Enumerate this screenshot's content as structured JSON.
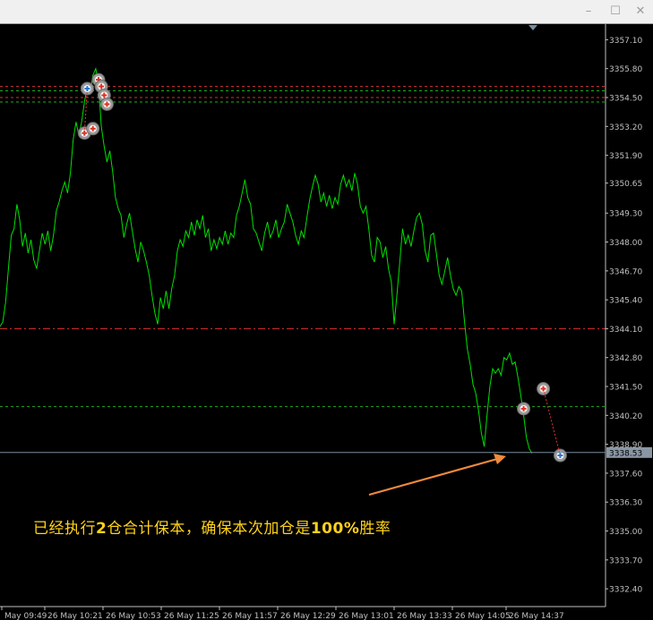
{
  "window": {
    "buttons": [
      "–",
      "☐",
      "✕"
    ]
  },
  "annotation": {
    "part1": "已经执行",
    "num1": "2",
    "part2": "仓合计保本，确保本次加仓是",
    "num2": "100%",
    "part3": "胜率"
  },
  "colors": {
    "background": "#000000",
    "price_line": "#00e000",
    "axis_text": "#c0c0c0",
    "level_red": "#e03030",
    "level_green": "#1fae1f",
    "current_line": "#7a8ca0",
    "arrow": "#f08a3c",
    "annotation": "#ffd21a"
  },
  "chart_data": {
    "type": "line",
    "ylim": [
      3331.6,
      3357.8
    ],
    "y_ticks": [
      "3357.10",
      "3355.80",
      "3354.50",
      "3353.20",
      "3351.90",
      "3350.65",
      "3349.30",
      "3348.00",
      "3346.70",
      "3345.40",
      "3344.10",
      "3342.80",
      "3341.50",
      "3340.20",
      "3338.90",
      "3337.60",
      "3336.30",
      "3335.00",
      "3333.70",
      "3332.40"
    ],
    "x_ticks": [
      "May 09:49",
      "26 May 10:21",
      "26 May 10:53",
      "26 May 11:25",
      "26 May 11:57",
      "26 May 12:29",
      "26 May 13:01",
      "26 May 13:33",
      "26 May 14:05",
      "26 May 14:37"
    ],
    "current_price": "3338.53",
    "series": [
      {
        "values": [
          3344.2,
          3344.4,
          3345.3,
          3346.8,
          3348.3,
          3348.6,
          3349.7,
          3349.0,
          3347.8,
          3348.4,
          3347.5,
          3348.1,
          3347.2,
          3346.8,
          3347.6,
          3348.4,
          3347.9,
          3348.5,
          3347.6,
          3348.3,
          3349.4,
          3349.8,
          3350.3,
          3350.7,
          3350.2,
          3351.1,
          3352.6,
          3353.4,
          3352.8,
          3353.4,
          3354.3,
          3355.0,
          3354.7,
          3355.5,
          3355.8,
          3355.1,
          3353.2,
          3352.3,
          3351.6,
          3352.1,
          3351.2,
          3350.0,
          3349.5,
          3349.2,
          3348.2,
          3348.8,
          3349.3,
          3348.5,
          3347.7,
          3347.1,
          3348.0,
          3347.6,
          3347.1,
          3346.5,
          3345.6,
          3344.8,
          3344.3,
          3345.5,
          3345.0,
          3345.8,
          3345.0,
          3345.9,
          3346.5,
          3347.6,
          3348.1,
          3347.8,
          3348.5,
          3348.2,
          3348.9,
          3348.3,
          3349.0,
          3348.6,
          3349.2,
          3348.2,
          3348.6,
          3347.6,
          3348.1,
          3347.7,
          3348.2,
          3347.9,
          3348.5,
          3347.9,
          3348.4,
          3348.2,
          3349.2,
          3349.6,
          3350.2,
          3350.8,
          3350.0,
          3349.7,
          3348.6,
          3348.4,
          3348.0,
          3347.6,
          3348.4,
          3348.9,
          3348.2,
          3348.5,
          3349.0,
          3348.2,
          3348.6,
          3348.9,
          3349.7,
          3349.3,
          3348.9,
          3348.3,
          3347.9,
          3348.5,
          3348.2,
          3349.1,
          3349.9,
          3350.5,
          3351.0,
          3350.6,
          3349.8,
          3350.2,
          3349.6,
          3350.1,
          3349.5,
          3350.0,
          3349.7,
          3350.6,
          3351.0,
          3350.5,
          3350.8,
          3350.3,
          3351.1,
          3350.6,
          3349.6,
          3349.3,
          3349.6,
          3348.6,
          3347.4,
          3347.1,
          3348.2,
          3348.0,
          3347.3,
          3347.8,
          3346.8,
          3346.2,
          3344.3,
          3345.6,
          3347.1,
          3348.6,
          3347.9,
          3348.3,
          3347.8,
          3348.5,
          3349.1,
          3349.3,
          3348.8,
          3347.6,
          3347.1,
          3348.3,
          3348.4,
          3347.5,
          3346.5,
          3346.1,
          3346.7,
          3347.3,
          3346.5,
          3345.9,
          3345.6,
          3346.0,
          3345.8,
          3344.4,
          3343.2,
          3342.5,
          3341.6,
          3341.2,
          3340.4,
          3339.4,
          3338.8,
          3340.2,
          3341.5,
          3342.3,
          3342.1,
          3342.3,
          3342.0,
          3342.8,
          3342.7,
          3343.0,
          3342.5,
          3342.6,
          3341.9,
          3341.1,
          3340.2,
          3339.2,
          3338.7,
          3338.5
        ]
      }
    ],
    "levels": [
      {
        "price": 3355.0,
        "color": "red",
        "style": "dashed"
      },
      {
        "price": 3354.8,
        "color": "green",
        "style": "dashed"
      },
      {
        "price": 3354.5,
        "color": "red",
        "style": "dashed"
      },
      {
        "price": 3354.3,
        "color": "green",
        "style": "dashed"
      },
      {
        "price": 3344.1,
        "color": "red",
        "style": "dashdot"
      },
      {
        "price": 3340.6,
        "color": "green",
        "style": "dashed"
      }
    ],
    "markers": [
      {
        "index": 31,
        "price": 3354.9,
        "kind": "buy"
      },
      {
        "index": 30,
        "price": 3352.9,
        "kind": "sell"
      },
      {
        "index": 33,
        "price": 3353.1,
        "kind": "sell"
      },
      {
        "index": 35,
        "price": 3355.3,
        "kind": "sell"
      },
      {
        "index": 36,
        "price": 3355.0,
        "kind": "sell"
      },
      {
        "index": 37,
        "price": 3354.6,
        "kind": "sell"
      },
      {
        "index": 38,
        "price": 3354.2,
        "kind": "sell"
      },
      {
        "index": 186,
        "price": 3340.5,
        "kind": "sell"
      },
      {
        "index": 193,
        "price": 3341.4,
        "kind": "sell"
      },
      {
        "index": 199,
        "price": 3338.4,
        "kind": "buy"
      }
    ]
  }
}
